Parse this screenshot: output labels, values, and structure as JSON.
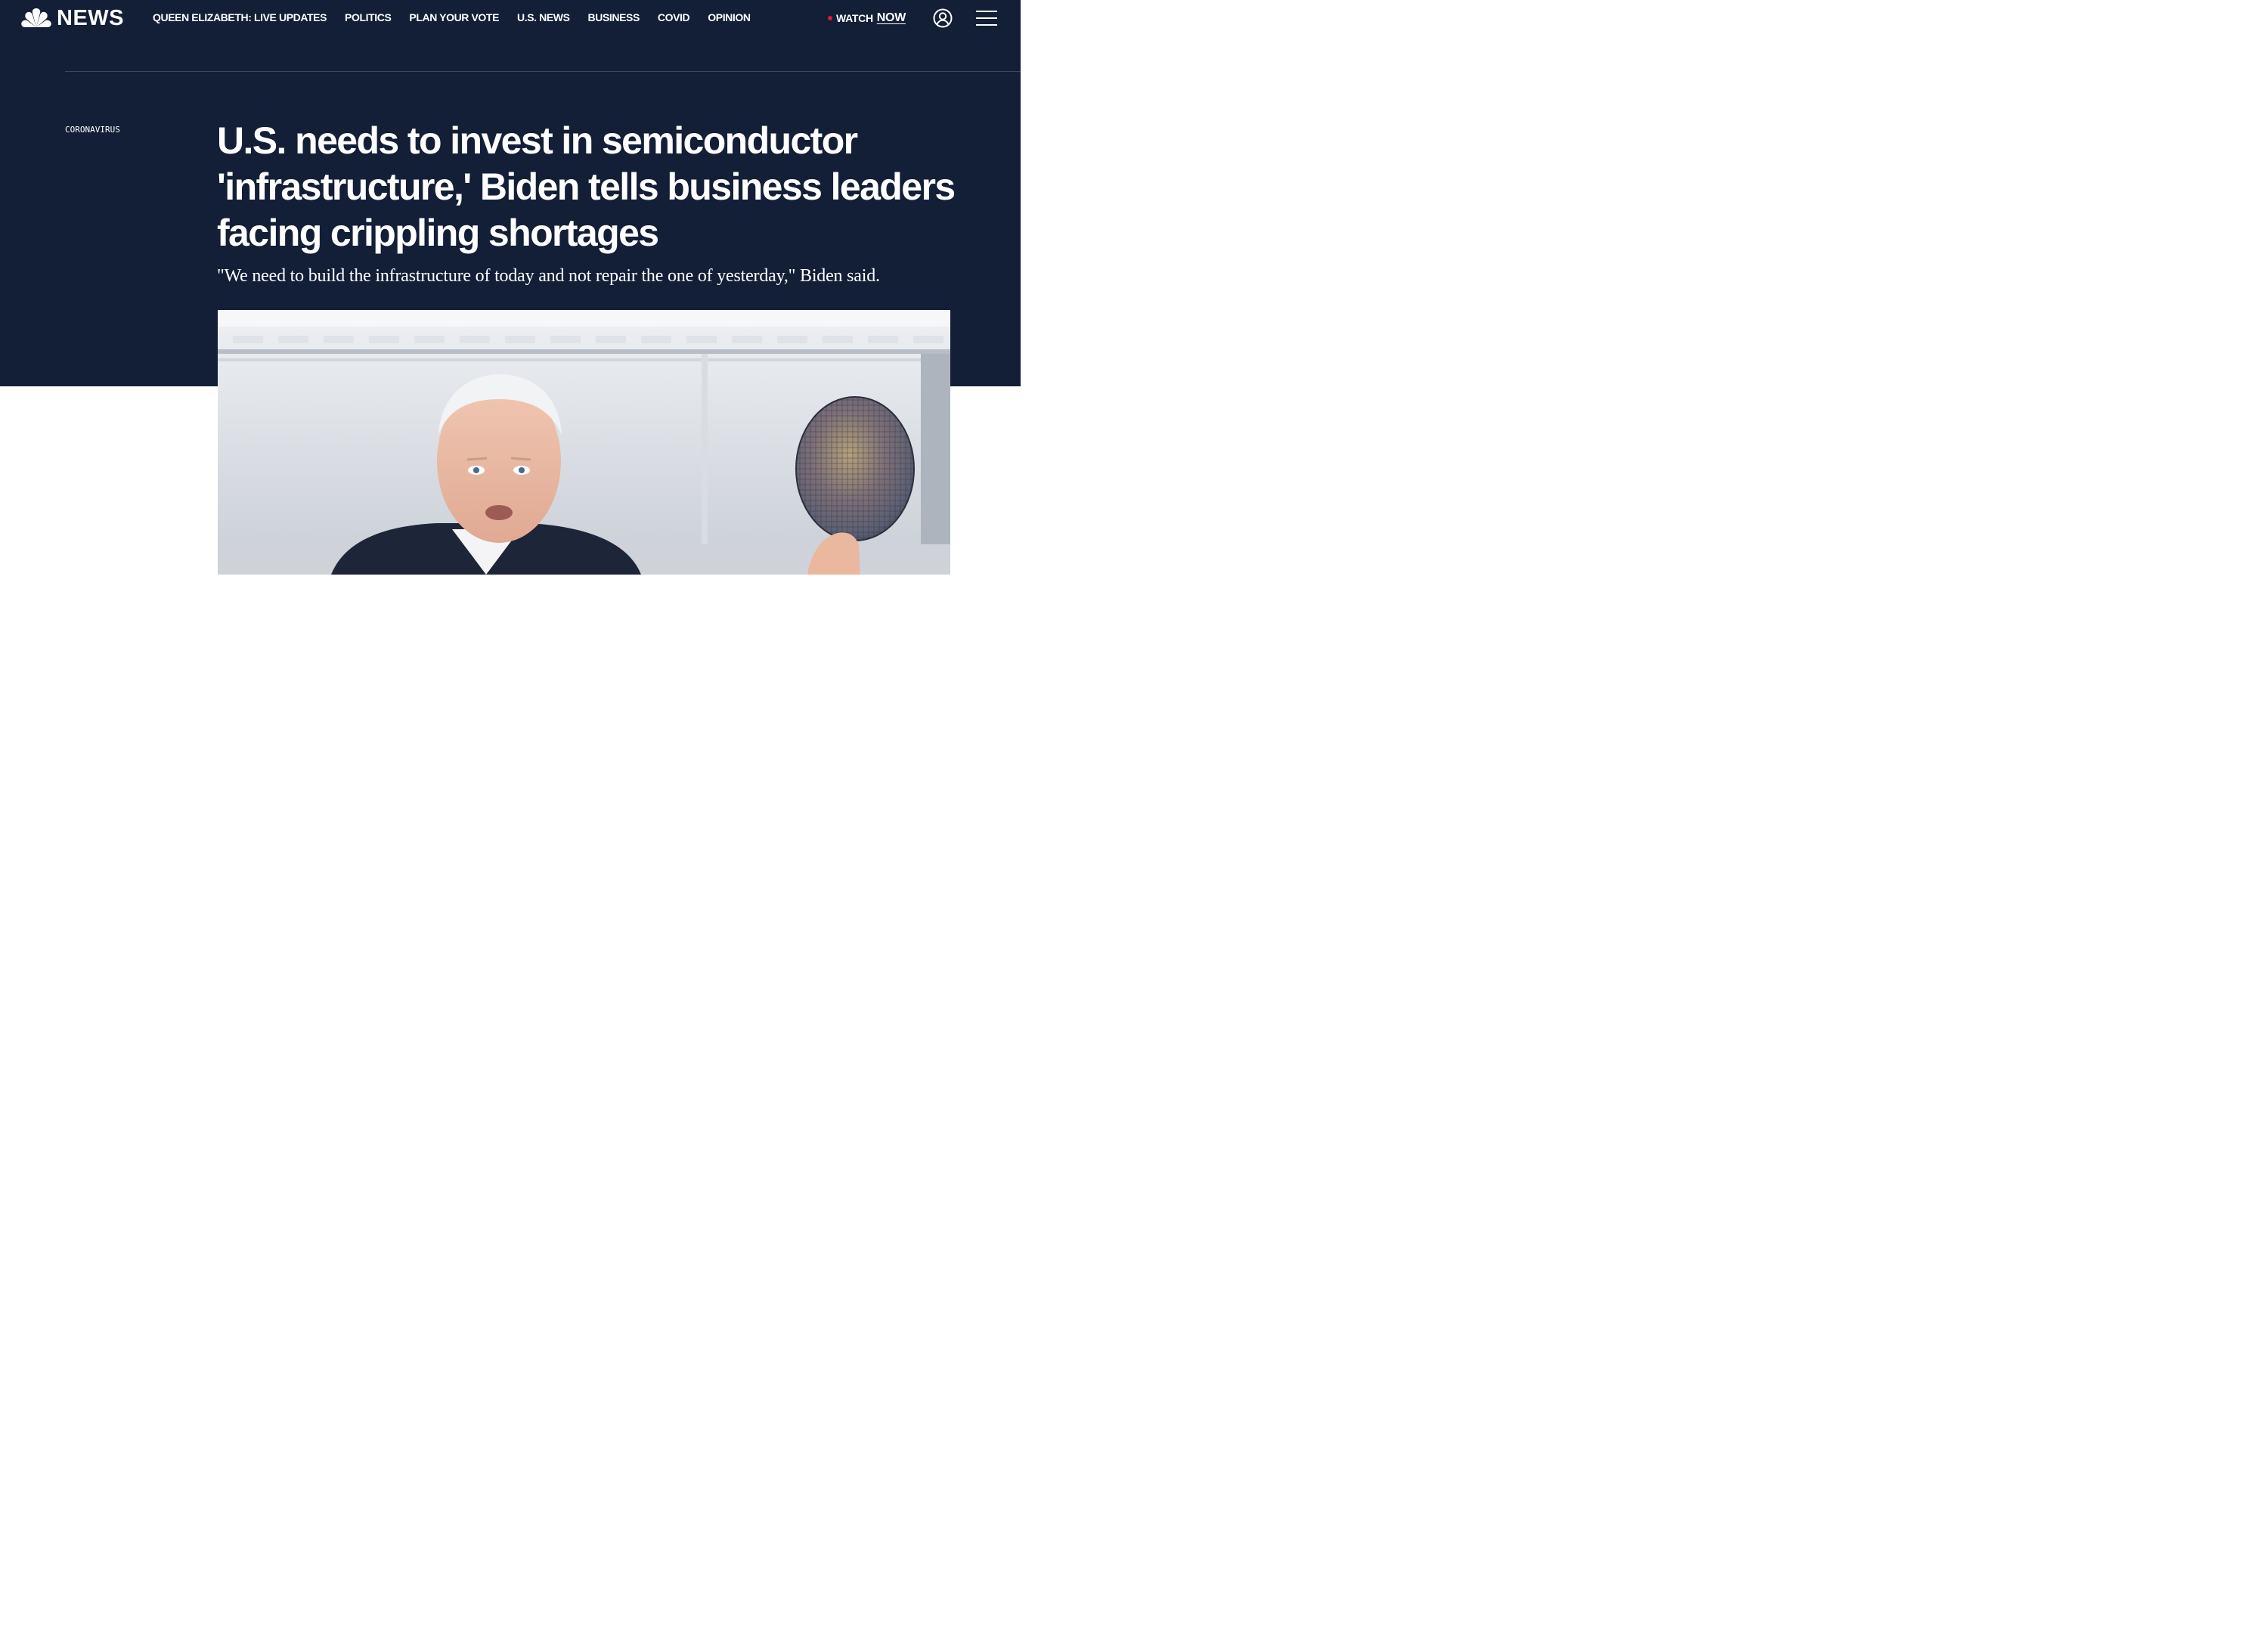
{
  "brand": {
    "wordmark": "NEWS",
    "logo_icon": "nbc-peacock-icon"
  },
  "nav": {
    "items": [
      {
        "label": "QUEEN ELIZABETH: LIVE UPDATES"
      },
      {
        "label": "POLITICS"
      },
      {
        "label": "PLAN YOUR VOTE"
      },
      {
        "label": "U.S. NEWS"
      },
      {
        "label": "BUSINESS"
      },
      {
        "label": "COVID"
      },
      {
        "label": "OPINION"
      }
    ],
    "watch_label": "WATCH",
    "watch_now": "NOW",
    "account_icon": "account-icon",
    "menu_icon": "hamburger-menu-icon"
  },
  "article": {
    "section_label": "CORONAVIRUS",
    "headline": "U.S. needs to invest in semiconductor 'infrastructure,' Biden tells business leaders facing crippling shortages",
    "dek": "\"We need to build the infrastructure of today and not repair the one of yesterday,\" Biden said."
  },
  "colors": {
    "hero_background": "#121f36",
    "live_dot": "#e0192f",
    "text": "#ffffff"
  }
}
